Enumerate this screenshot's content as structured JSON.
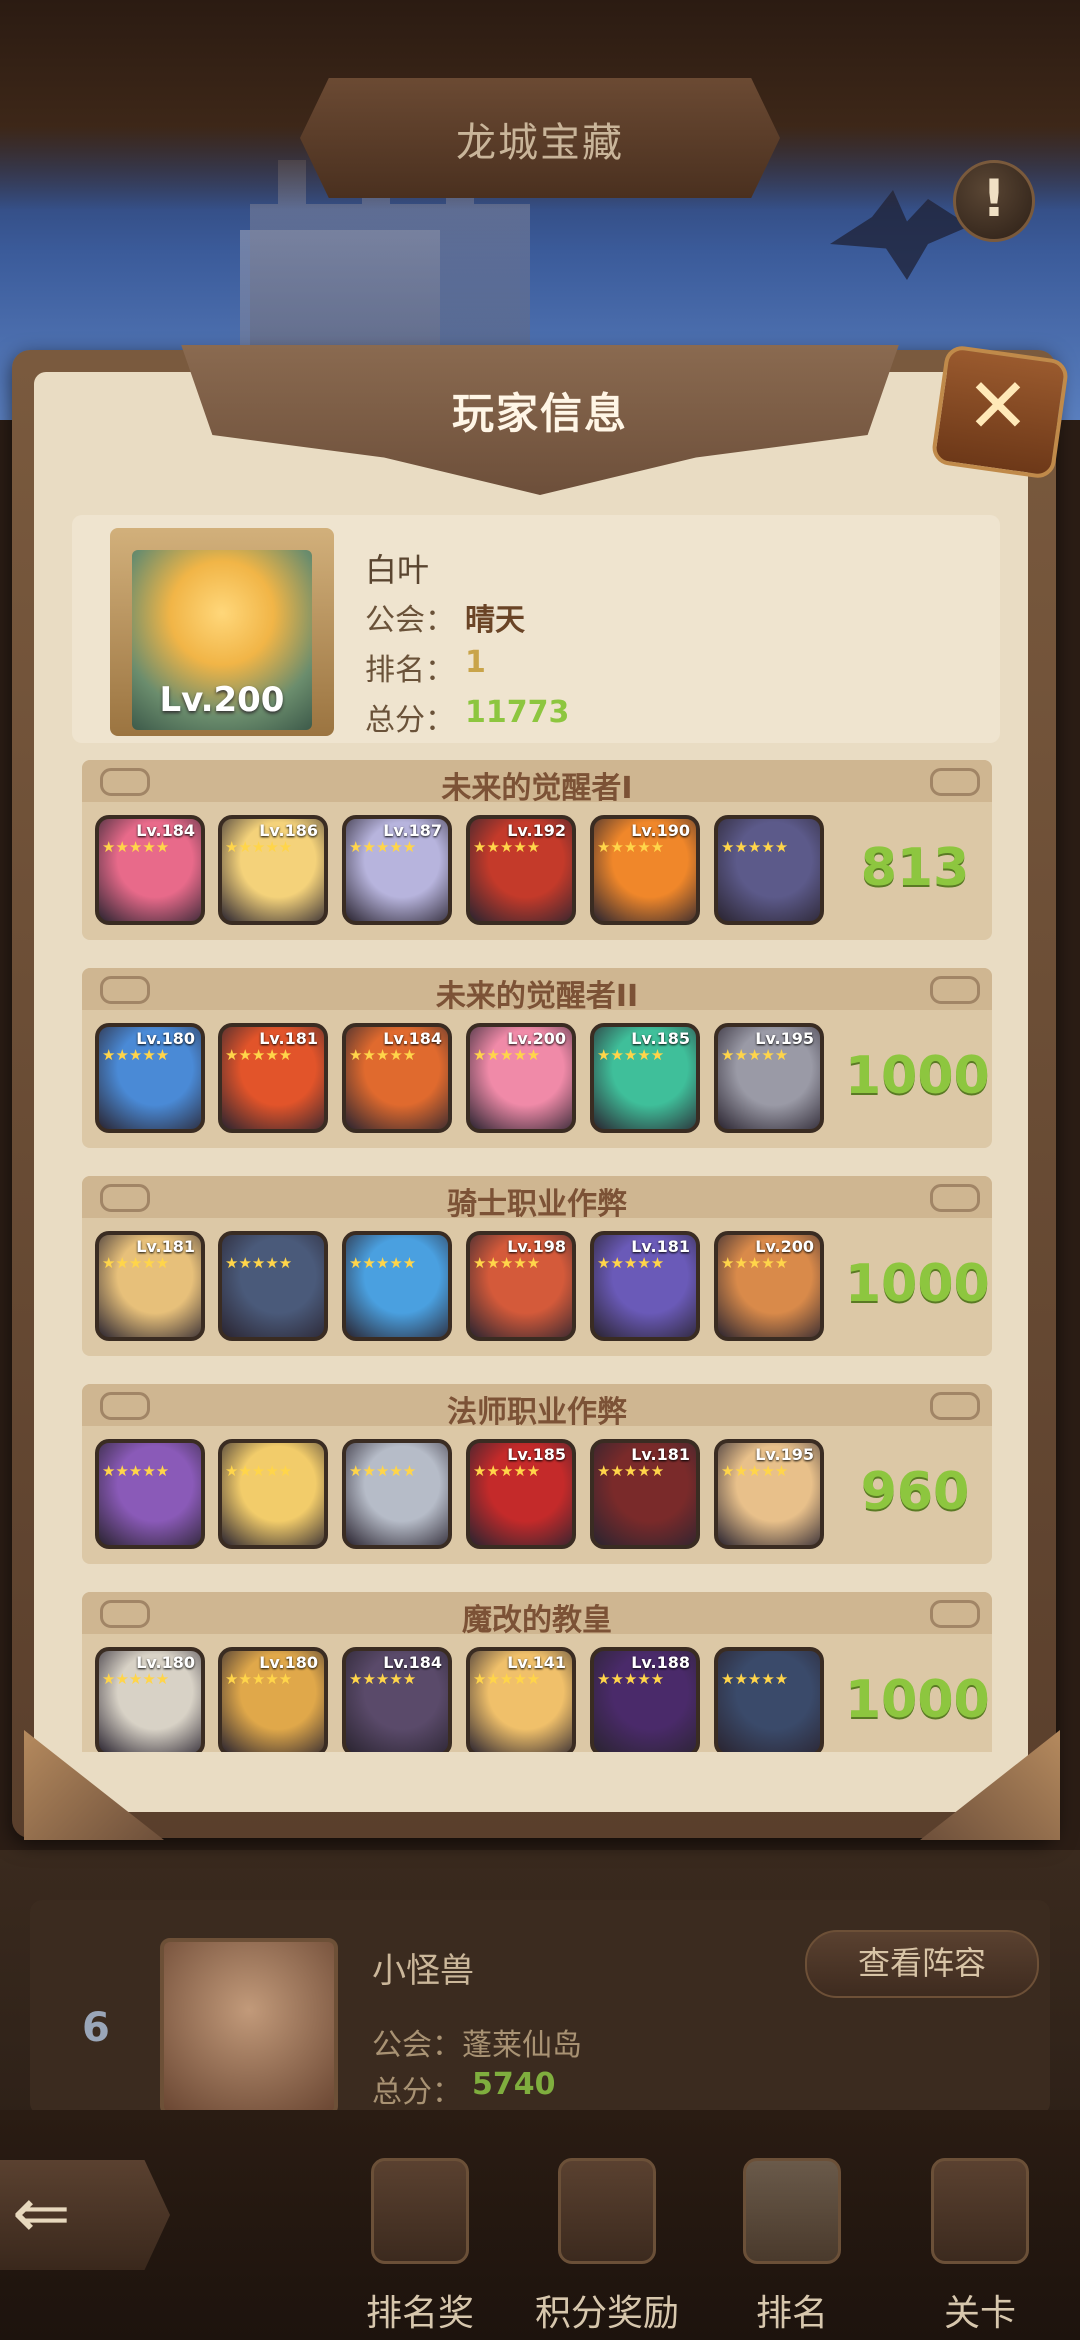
{
  "screen": {
    "banner_title": "龙城宝藏",
    "alert_label": "!"
  },
  "modal": {
    "title": "玩家信息",
    "close_label": "✕",
    "player": {
      "name": "白叶",
      "level": "Lv.200",
      "guild_label": "公会：",
      "guild_value": "晴天",
      "rank_label": "排名：",
      "rank_value": "1",
      "score_label": "总分：",
      "score_value": "11773"
    },
    "teams": [
      {
        "title": "未来的觉醒者I",
        "score": "813",
        "heroes": [
          {
            "lv": "Lv.184",
            "color": "#e86a8a"
          },
          {
            "lv": "Lv.186",
            "color": "#f4d27a"
          },
          {
            "lv": "Lv.187",
            "color": "#b7b4dd"
          },
          {
            "lv": "Lv.192",
            "color": "#c43a2a"
          },
          {
            "lv": "Lv.190",
            "color": "#f0872a"
          },
          {
            "lv": "",
            "color": "#5c5a8a"
          }
        ]
      },
      {
        "title": "未来的觉醒者II",
        "score": "1000",
        "heroes": [
          {
            "lv": "Lv.180",
            "color": "#4a8ad6"
          },
          {
            "lv": "Lv.181",
            "color": "#e2542a"
          },
          {
            "lv": "Lv.184",
            "color": "#e06a2e"
          },
          {
            "lv": "Lv.200",
            "color": "#f08aa8"
          },
          {
            "lv": "Lv.185",
            "color": "#3fbf9a"
          },
          {
            "lv": "Lv.195",
            "color": "#9a9aa6"
          }
        ]
      },
      {
        "title": "骑士职业作弊",
        "score": "1000",
        "heroes": [
          {
            "lv": "Lv.181",
            "color": "#e7c07a"
          },
          {
            "lv": "",
            "color": "#4a5a7a"
          },
          {
            "lv": "",
            "color": "#4aa0e0"
          },
          {
            "lv": "Lv.198",
            "color": "#d45a3a"
          },
          {
            "lv": "Lv.181",
            "color": "#6a5ab8"
          },
          {
            "lv": "Lv.200",
            "color": "#d98a4a"
          }
        ]
      },
      {
        "title": "法师职业作弊",
        "score": "960",
        "heroes": [
          {
            "lv": "",
            "color": "#8a5ab8"
          },
          {
            "lv": "",
            "color": "#f2cc6a"
          },
          {
            "lv": "",
            "color": "#b6bcc8"
          },
          {
            "lv": "Lv.185",
            "color": "#c42a2a"
          },
          {
            "lv": "Lv.181",
            "color": "#7a2a2a"
          },
          {
            "lv": "Lv.195",
            "color": "#e8c08a"
          }
        ]
      },
      {
        "title": "魔改的教皇",
        "score": "1000",
        "heroes": [
          {
            "lv": "Lv.180",
            "color": "#d8d2c6"
          },
          {
            "lv": "Lv.180",
            "color": "#e0a84a"
          },
          {
            "lv": "Lv.184",
            "color": "#5a4a6a"
          },
          {
            "lv": "Lv.141",
            "color": "#f0c06a"
          },
          {
            "lv": "Lv.188",
            "color": "#4a2a6a"
          },
          {
            "lv": "",
            "color": "#3a4a6a"
          }
        ]
      }
    ]
  },
  "ranking_row": {
    "rank": "6",
    "name": "小怪兽",
    "guild_label": "公会：",
    "guild_value": "蓬莱仙岛",
    "score_label": "总分：",
    "score_value": "5740",
    "view_button": "查看阵容"
  },
  "bottom_nav": {
    "back_arrow": "⇐",
    "items": [
      {
        "label": "排名奖",
        "icon": "trophy-icon"
      },
      {
        "label": "积分奖励",
        "icon": "scroll-icon"
      },
      {
        "label": "排名",
        "icon": "ranking-icon"
      },
      {
        "label": "关卡",
        "icon": "stage-icon"
      }
    ]
  }
}
